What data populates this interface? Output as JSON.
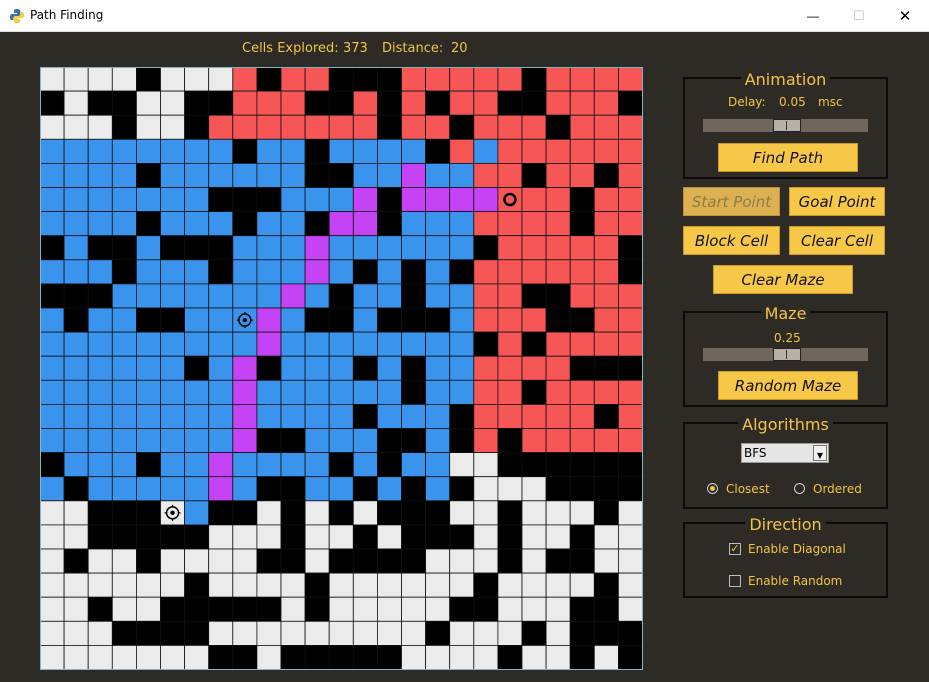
{
  "window": {
    "title": "Path Finding",
    "minimize_glyph": "—",
    "maximize_glyph": "☐",
    "close_glyph": "✕"
  },
  "stats": {
    "cells_label": "Cells Explored:",
    "cells_value": "373",
    "distance_label": "Distance:",
    "distance_value": "20"
  },
  "animation": {
    "title": "Animation",
    "delay_label": "Delay:",
    "delay_value": "0.05",
    "delay_unit": "msc",
    "delay_slider_fraction": 0.45,
    "find_path_label": "Find Path"
  },
  "points": {
    "start_label": "Start Point",
    "goal_label": "Goal Point",
    "block_label": "Block Cell",
    "clear_cell_label": "Clear Cell",
    "clear_maze_label": "Clear Maze"
  },
  "maze": {
    "title": "Maze",
    "density_value": "0.25",
    "density_slider_fraction": 0.45,
    "random_maze_label": "Random Maze"
  },
  "algorithms": {
    "title": "Algorithms",
    "selected": "BFS",
    "order_options": [
      {
        "label": "Closest",
        "checked": true
      },
      {
        "label": "Ordered",
        "checked": false
      }
    ]
  },
  "direction": {
    "title": "Direction",
    "options": [
      {
        "label": "Enable Diagonal",
        "checked": true
      },
      {
        "label": "Enable Random",
        "checked": false
      }
    ]
  },
  "colors": {
    "free": "#ebebeb",
    "wall": "#000000",
    "explored_goal": "#f65656",
    "explored_start": "#3a93ec",
    "path": "#c643f5",
    "accent": "#f2c444",
    "button": "#f7c748"
  },
  "grid": {
    "size": 25,
    "legend": "W=wall, .=free, R=red explored, B=blue explored, P=path",
    "markers": {
      "start": [
        18,
        5
      ],
      "waypoint": [
        10,
        8
      ],
      "goal": [
        5,
        19
      ]
    },
    "rows": [
      "....W...RWRRWWWRRRRRWRRRR",
      "W.WW..WWRRRWWRWRWRRWWRRRW",
      "...W..WRRRRRRRWRRWRRRWRRR",
      "BBBBBBBBWBBWBBBBWRBRRRRRR",
      "BBBBWBBBBBBWWBBPBBRRWRRWR",
      "BBBBBBBWWWBBBPWPPPPRRRWRR",
      "BBBBWBBBWBBWPPWBBBRRRRWRR",
      "WBWWBWWWBBBPBBBBBBWRRRRRW",
      "BBBWBBBWBBBPBWBWBWRRRRRRW",
      "WWWBBBBBBBPBWBBWBBRRWWRRR",
      "BWBBWWBBBPBWWBWWWBRRRWWRR",
      "BBBBBBBBBPBBBBBBBBWRWRRRR",
      "BBBBBBWBPWBBBWBWBBRRRRWWW",
      "BBBBBBBBPBBBBBBWBBRRWRRRR",
      "BBBBBBBBPBBBBWBBBWRRRRRWR",
      "BBBBBBBBPWWBBBWWBWRWRRRRR",
      "WBBBWBBPBBBBWBWBB..WWWWWW",
      "BWBBBBBPBWWBBWBWBW...WWWW",
      "..WWW.BWW.W.W.WWW..W...W.",
      "..WWWWW...W..W.WWW.W..W..",
      ".W..W....WW.WWWW...W.WW..",
      "......W....W......W....W.",
      "..W..WWWWW.W.....WW...WW.",
      "...WWWW.........W...W.WWW",
      ".......WW.WWWWW....W..W.W"
    ]
  }
}
